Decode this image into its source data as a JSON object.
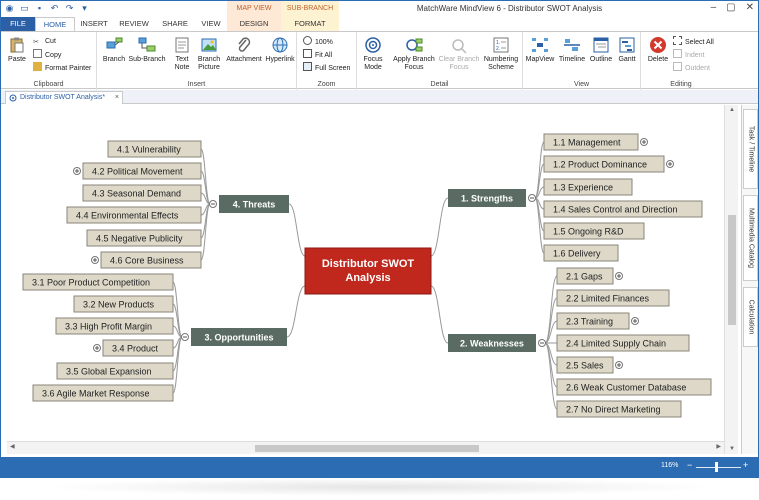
{
  "app": {
    "title": "MatchWare MindView 6 - Distributor SWOT Analysis",
    "window_buttons": [
      "–",
      "▢",
      "✕"
    ],
    "accent_color": "#2b6cb3"
  },
  "context_tabs": {
    "map_view": "MAP VIEW",
    "sub_branch": "SUB-BRANCH"
  },
  "tabs": [
    "FILE",
    "HOME",
    "INSERT",
    "REVIEW",
    "SHARE",
    "VIEW",
    "DESIGN",
    "FORMAT"
  ],
  "ribbon": {
    "clipboard": {
      "paste": "Paste",
      "cut": "Cut",
      "copy": "Copy",
      "format_painter": "Format Painter",
      "label": "Clipboard"
    },
    "insert": {
      "branch": "Branch",
      "sub_branch": "Sub-Branch",
      "text_note_1": "Text",
      "text_note_2": "Note",
      "branch_picture_1": "Branch",
      "branch_picture_2": "Picture",
      "attachment": "Attachment",
      "hyperlink": "Hyperlink",
      "label": "Insert"
    },
    "zoom": {
      "percent": "100%",
      "fit_all": "Fit All",
      "full_screen": "Full Screen",
      "label": "Zoom"
    },
    "detail": {
      "focus_mode_1": "Focus",
      "focus_mode_2": "Mode",
      "apply_focus_1": "Apply Branch",
      "apply_focus_2": "Focus",
      "clear_focus_1": "Clear Branch",
      "clear_focus_2": "Focus",
      "numbering_1": "Numbering",
      "numbering_2": "Scheme",
      "label": "Detail"
    },
    "view": {
      "mapview": "MapView",
      "timeline": "Timeline",
      "outline": "Outline",
      "gantt": "Gantt",
      "label": "View"
    },
    "editing": {
      "delete": "Delete",
      "select_all": "Select All",
      "indent": "Indent",
      "outdent": "Outdent",
      "label": "Editing"
    }
  },
  "document_tab": "Distributor SWOT Analysis*",
  "side_tabs": [
    "Task / Timeline",
    "Multimedia Catalog",
    "Calculation"
  ],
  "status": {
    "zoom": "116%"
  },
  "map": {
    "root": {
      "line1": "Distributor SWOT",
      "line2": "Analysis"
    },
    "strengths": {
      "label": "1.  Strengths",
      "items": [
        "1.1  Management",
        "1.2  Product Dominance",
        "1.3  Experience",
        "1.4  Sales Control and Direction",
        "1.5  Ongoing R&D",
        "1.6  Delivery"
      ]
    },
    "weaknesses": {
      "label": "2.  Weaknesses",
      "items": [
        "2.1  Gaps",
        "2.2  Limited Finances",
        "2.3  Training",
        "2.4  Limited Supply Chain",
        "2.5  Sales",
        "2.6  Weak Customer Database",
        "2.7  No Direct Marketing"
      ]
    },
    "threats": {
      "label": "4.  Threats",
      "items": [
        "4.1  Vulnerability",
        "4.2  Political Movement",
        "4.3  Seasonal Demand",
        "4.4  Environmental Effects",
        "4.5  Negative Publicity",
        "4.6  Core Business"
      ]
    },
    "opportunities": {
      "label": "3.  Opportunities",
      "items": [
        "3.1  Poor Product Competition",
        "3.2  New Products",
        "3.3  High Profit Margin",
        "3.4  Product",
        "3.5  Global Expansion",
        "3.6  Agile Market Response"
      ]
    },
    "colors": {
      "root_fill": "#c0281e",
      "main_fill": "#5a6b64",
      "leaf_fill": "#ddd8c8",
      "leaf_border": "#8a8678",
      "line": "#9a9a9a"
    }
  }
}
